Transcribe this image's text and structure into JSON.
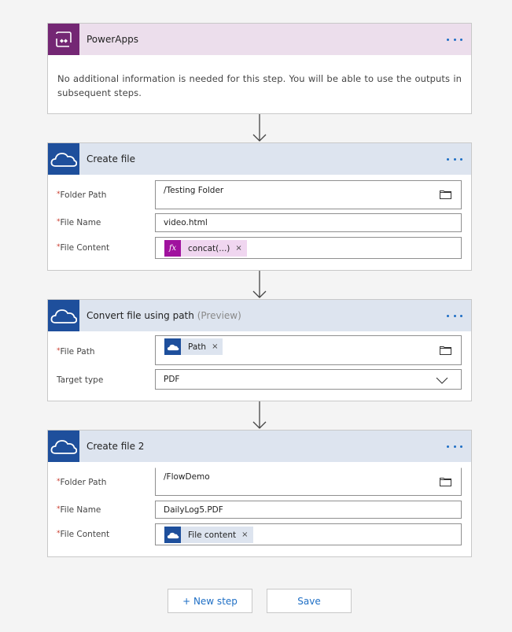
{
  "steps": [
    {
      "title": "PowerApps",
      "icon": "powerapps-icon",
      "menu_icon": "more-options-icon",
      "message": "No additional information is needed for this step. You will be able to use the outputs in subsequent steps."
    },
    {
      "title": "Create file",
      "icon": "onedrive-icon",
      "menu_icon": "more-options-icon",
      "fields": [
        {
          "label": "Folder Path",
          "required": "*",
          "value": "/Testing Folder",
          "action_icon": "folder-icon"
        },
        {
          "label": "File Name",
          "required": "*",
          "value": "video.html"
        },
        {
          "label": "File Content",
          "required": "*",
          "token": {
            "icon": "fx-icon",
            "icon_text": "fx",
            "label": "concat(...)",
            "remove": "×"
          }
        }
      ]
    },
    {
      "title": "Convert file using path",
      "title_suffix": "(Preview)",
      "icon": "onedrive-icon",
      "menu_icon": "more-options-icon",
      "fields": [
        {
          "label": "File Path",
          "required": "*",
          "token": {
            "icon": "onedrive-icon",
            "label": "Path",
            "remove": "×"
          },
          "action_icon": "folder-icon"
        },
        {
          "label": "Target type",
          "required": "",
          "value": "PDF",
          "action_icon": "chevron-down-icon"
        }
      ]
    },
    {
      "title": "Create file 2",
      "icon": "onedrive-icon",
      "menu_icon": "more-options-icon",
      "fields": [
        {
          "label": "Folder Path",
          "required": "*",
          "value": "/FlowDemo",
          "action_icon": "folder-icon"
        },
        {
          "label": "File Name",
          "required": "*",
          "value": "DailyLog5.PDF"
        },
        {
          "label": "File Content",
          "required": "*",
          "token": {
            "icon": "onedrive-icon",
            "label": "File content",
            "remove": "×"
          }
        }
      ]
    }
  ],
  "footer": {
    "new_step_label": "+ New step",
    "save_label": "Save"
  },
  "colors": {
    "powerapps_brand": "#742774",
    "onedrive_brand": "#1e4f9c",
    "accent": "#1f6fc5",
    "required": "#c8392b",
    "fx_token": "#a0129e"
  }
}
